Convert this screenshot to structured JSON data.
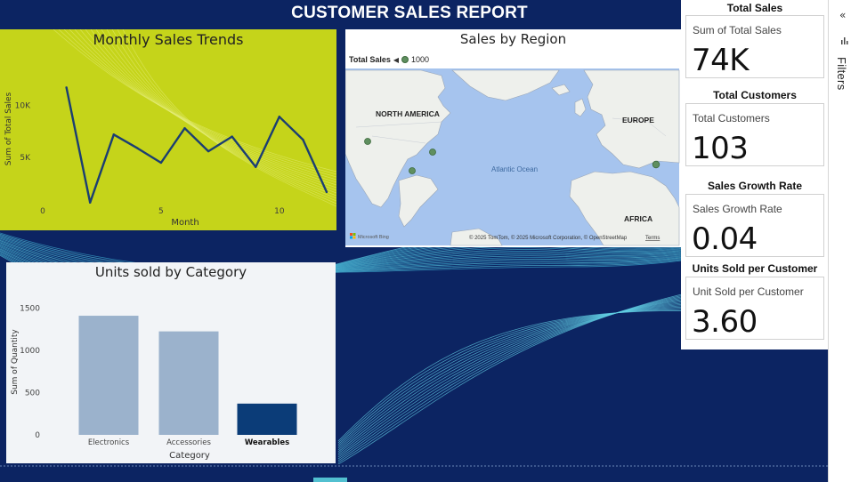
{
  "report": {
    "title": "CUSTOMER SALES REPORT"
  },
  "theme": {
    "background": "#0c2462",
    "line_chart_background": "#c5d41a",
    "line_color": "#1b3e72",
    "bar_color_light": "#9bb2cc",
    "bar_color_dark": "#0b3c78",
    "map_bubble_color": "#5f8f5f"
  },
  "monthly_chart": {
    "title": "Monthly Sales Trends",
    "xlabel": "Month",
    "ylabel": "Sum of Total Sales"
  },
  "region_map": {
    "title": "Sales by Region",
    "legend_title": "Total Sales",
    "legend_value": "1000",
    "labels": {
      "north_america": "NORTH AMERICA",
      "europe": "EUROPE",
      "africa": "AFRICA",
      "ocean": "Atlantic Ocean"
    },
    "attribution": "© 2025 TomTom, © 2025 Microsoft Corporation, © OpenStreetMap",
    "terms": "Terms",
    "logo_text": "Microsoft Bing"
  },
  "category_chart": {
    "title": "Units sold by Category"
  },
  "cards": [
    {
      "header": "Total Sales",
      "label": "Sum of Total Sales",
      "value": "74K"
    },
    {
      "header": "Total Customers",
      "label": "Total Customers",
      "value": "103"
    },
    {
      "header": "Sales Growth Rate",
      "label": "Sales Growth Rate",
      "value": "0.04"
    },
    {
      "header": "Units Sold per Customer",
      "label": "Unit Sold per Customer",
      "value": "3.60"
    }
  ],
  "filters": {
    "label": "Filters",
    "collapse_icon": "double-chevron-left-icon",
    "filter_icon": "filter-bars-icon"
  },
  "chart_data": [
    {
      "type": "line",
      "title": "Monthly Sales Trends",
      "xlabel": "Month",
      "ylabel": "Sum of Total Sales",
      "x": [
        1,
        2,
        3,
        4,
        5,
        6,
        7,
        8,
        9,
        10,
        11,
        12
      ],
      "series": [
        {
          "values": [
            11700,
            700,
            7200,
            5900,
            4500,
            7800,
            5600,
            7000,
            4100,
            8900,
            6700,
            1700
          ]
        }
      ],
      "xlim": [
        0,
        12
      ],
      "ylim": [
        0,
        13000
      ],
      "xticks": [
        0,
        5,
        10
      ],
      "xtick_labels": [
        "0",
        "5",
        "10"
      ],
      "yticks": [
        5000,
        10000
      ],
      "ytick_labels": [
        "5K",
        "10K"
      ],
      "grid": false
    },
    {
      "type": "bar",
      "title": "Units sold by Category",
      "xlabel": "Category",
      "ylabel": "Sum of Quantity",
      "categories": [
        "Electronics",
        "Accessories",
        "Wearables"
      ],
      "values": [
        1410,
        1225,
        370
      ],
      "highlighted": "Wearables",
      "ylim": [
        0,
        1600
      ],
      "yticks": [
        0,
        500,
        1000,
        1500
      ],
      "ytick_labels": [
        "0",
        "500",
        "1000",
        "1500"
      ],
      "grid": false
    }
  ]
}
